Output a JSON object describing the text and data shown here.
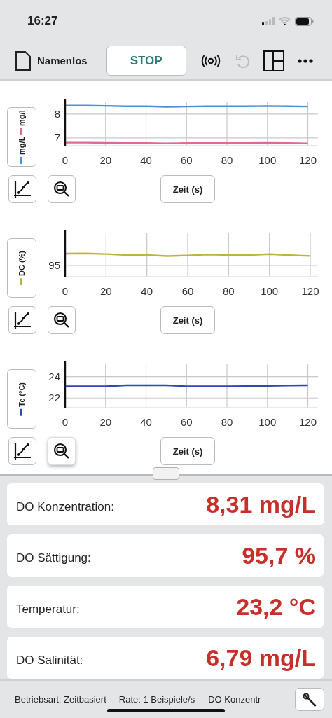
{
  "status_bar": {
    "time": "16:27"
  },
  "toolbar": {
    "file_name": "Namenlos",
    "stop_button": "STOP"
  },
  "graphs": [
    {
      "zoom_active": false,
      "chart_data": {
        "type": "line",
        "xlabel": "Zeit (s)",
        "grid": true,
        "x": [
          0,
          10,
          20,
          30,
          40,
          50,
          60,
          70,
          80,
          90,
          100,
          110,
          120
        ],
        "xlim": [
          0,
          125
        ],
        "ylim": [
          6.67,
          8.5
        ],
        "xticks": [
          0,
          20,
          40,
          60,
          80,
          100,
          120
        ],
        "yticks": [
          7,
          8
        ],
        "series": [
          {
            "name": "mg/L",
            "color": "#4a8fd8",
            "values": [
              8.36,
              8.36,
              8.35,
              8.33,
              8.33,
              8.31,
              8.32,
              8.33,
              8.33,
              8.33,
              8.34,
              8.33,
              8.32
            ]
          },
          {
            "name": "mg/l",
            "color": "#e0689a",
            "values": [
              6.8,
              6.8,
              6.79,
              6.78,
              6.78,
              6.77,
              6.78,
              6.78,
              6.78,
              6.78,
              6.79,
              6.78,
              6.77
            ]
          }
        ]
      }
    },
    {
      "zoom_active": false,
      "plot": {
        "xlabel": "Zeit (s)",
        "x_tick_labels": [
          "0",
          "20",
          "40",
          "60",
          "80",
          "100",
          "120"
        ],
        "y_tick_labels": [
          "95"
        ],
        "legend": [
          {
            "name": "DC (%)",
            "color": "#bdb53a"
          }
        ]
      }
    },
    {
      "zoom_active": true,
      "chart_data": {
        "type": "line",
        "xlabel": "Zeit (s)",
        "grid": true,
        "x": [
          0,
          10,
          20,
          30,
          40,
          50,
          60,
          70,
          80,
          90,
          100,
          110,
          120
        ],
        "xlim": [
          0,
          125
        ],
        "ylim": [
          21.1,
          25.16
        ],
        "xticks": [
          0,
          20,
          40,
          60,
          80,
          100,
          120
        ],
        "yticks": [
          22,
          24
        ],
        "series": [
          {
            "name": "Te (°C)",
            "color": "#3346b5",
            "values": [
              23.1,
              23.1,
              23.1,
              23.2,
              23.2,
              23.2,
              23.1,
              23.1,
              23.1,
              23.12,
              23.15,
              23.18,
              23.2
            ]
          }
        ]
      }
    }
  ],
  "meters": [
    {
      "label": "DO Konzentration:",
      "value": "8,31 mg/L"
    },
    {
      "label": "DO Sättigung:",
      "value": "95,7 %"
    },
    {
      "label": "Temperatur:",
      "value": "23,2 °C"
    },
    {
      "label": "DO Salinität:",
      "value": "6,79 mg/L"
    }
  ],
  "footer": {
    "mode": "Betriebsart: Zeitbasiert",
    "rate": "Rate: 1 Beispiele/s",
    "column_3": "DO Konzentr"
  }
}
